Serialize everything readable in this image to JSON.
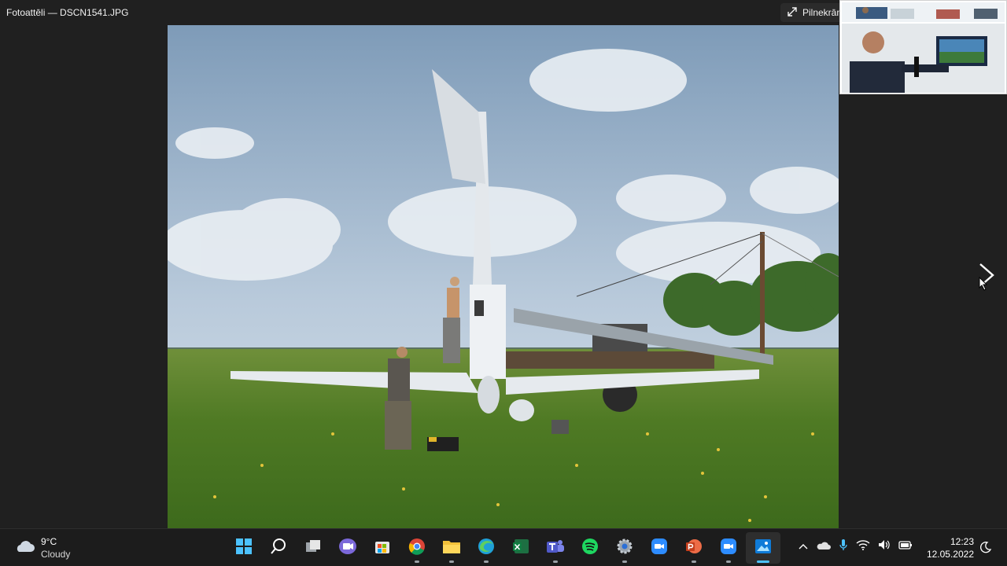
{
  "window": {
    "title": "Fotoattēli — DSCN1541.JPG",
    "fullscreen_label": "Pilnekrān"
  },
  "photo": {
    "description_icon": "photo-wind-turbine"
  },
  "navigation": {
    "next_icon": "chevron-right-icon"
  },
  "weather": {
    "temperature": "9°C",
    "condition": "Cloudy",
    "icon": "cloud-icon"
  },
  "taskbar": {
    "apps": [
      {
        "name": "start",
        "icon": "windows-logo-icon",
        "running": false
      },
      {
        "name": "search",
        "icon": "search-icon",
        "running": false
      },
      {
        "name": "task-view",
        "icon": "task-view-icon",
        "running": false
      },
      {
        "name": "chat",
        "icon": "chat-icon",
        "running": false
      },
      {
        "name": "store",
        "icon": "store-icon",
        "running": false
      },
      {
        "name": "chrome",
        "icon": "chrome-icon",
        "running": true
      },
      {
        "name": "file-explorer",
        "icon": "folder-icon",
        "running": true
      },
      {
        "name": "edge",
        "icon": "edge-icon",
        "running": true
      },
      {
        "name": "excel",
        "icon": "excel-icon",
        "running": false
      },
      {
        "name": "teams",
        "icon": "teams-icon",
        "running": true
      },
      {
        "name": "spotify",
        "icon": "spotify-icon",
        "running": false
      },
      {
        "name": "settings",
        "icon": "settings-icon",
        "running": true
      },
      {
        "name": "zoom",
        "icon": "zoom-icon",
        "running": false
      },
      {
        "name": "powerpoint",
        "icon": "powerpoint-icon",
        "running": true
      },
      {
        "name": "zoom-meeting",
        "icon": "zoom-icon",
        "running": true
      },
      {
        "name": "photos",
        "icon": "photos-icon",
        "running": true,
        "active": true
      }
    ],
    "colors": {
      "accent": "#4cc2ff",
      "taskbar_bg": "#1c1c1c"
    }
  },
  "tray": {
    "icons": [
      "chevron-up-icon",
      "onedrive-icon",
      "microphone-icon",
      "wifi-icon",
      "volume-icon",
      "battery-icon"
    ]
  },
  "clock": {
    "time": "12:23",
    "date": "12.05.2022"
  }
}
